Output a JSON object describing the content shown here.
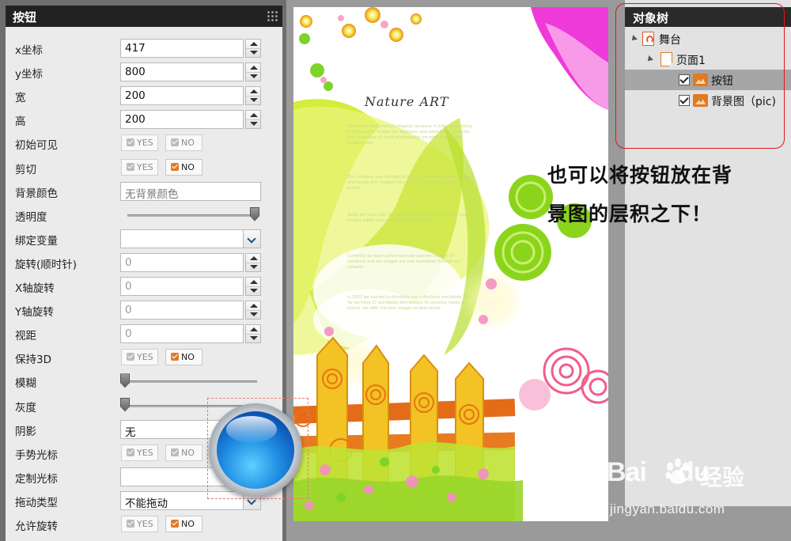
{
  "left_panel": {
    "title": "按钮",
    "properties": [
      {
        "label": "x坐标",
        "type": "number",
        "value": "417"
      },
      {
        "label": "y坐标",
        "type": "number",
        "value": "800"
      },
      {
        "label": "宽",
        "type": "number",
        "value": "200"
      },
      {
        "label": "高",
        "type": "number",
        "value": "200"
      },
      {
        "label": "初始可见",
        "type": "toggle",
        "selected": "none"
      },
      {
        "label": "剪切",
        "type": "toggle",
        "selected": "NO"
      },
      {
        "label": "背景颜色",
        "type": "text",
        "placeholder": "无背景颜色"
      },
      {
        "label": "透明度",
        "type": "slider",
        "level": 1.0
      },
      {
        "label": "绑定变量",
        "type": "select",
        "value": ""
      },
      {
        "label": "旋转(顺时针)",
        "type": "number",
        "value": "0"
      },
      {
        "label": "X轴旋转",
        "type": "number",
        "value": "0"
      },
      {
        "label": "Y轴旋转",
        "type": "number",
        "value": "0"
      },
      {
        "label": "视距",
        "type": "number",
        "value": "0"
      },
      {
        "label": "保持3D",
        "type": "toggle",
        "selected": "NO"
      },
      {
        "label": "模糊",
        "type": "slider",
        "level": 0.0
      },
      {
        "label": "灰度",
        "type": "slider",
        "level": 0.0
      },
      {
        "label": "阴影",
        "type": "select",
        "value": "无"
      },
      {
        "label": "手势光标",
        "type": "toggle",
        "selected": "none"
      },
      {
        "label": "定制光标",
        "type": "select",
        "value": ""
      },
      {
        "label": "拖动类型",
        "type": "select",
        "value": "不能拖动"
      },
      {
        "label": "允许旋转",
        "type": "toggle",
        "selected": "NO"
      }
    ],
    "yes_label": "YES",
    "no_label": "NO",
    "accent_color": "#e07a24"
  },
  "stage": {
    "title": "Nature ART",
    "paragraphs": [
      "We are the first creative imaging company in India specializing in high quality images for designers and advertising agencies. Our collections of stock photography are produced by top professionals.",
      "The company was founded to help in promoting artistic images and design with images from all over the world at affordable prices.",
      "Today we have over 10 million images with over 15,000 new images added every month to our collection.",
      "Currently we have active business partners in over 30 countries and our images are sold worldwide through our network.",
      "In 2002 we started to distribute our collections worldwide. So far we have 27 worldwide distributors. As growing needs of clients, we offer the best images at best prices."
    ]
  },
  "object_tree": {
    "title": "对象树",
    "nodes": [
      {
        "label": "舞台",
        "icon": "stage-icon",
        "level": 0
      },
      {
        "label": "页面1",
        "icon": "page-icon",
        "level": 1
      },
      {
        "label": "按钮",
        "icon": "image-icon",
        "level": 2,
        "checked": true,
        "selected": true
      },
      {
        "label": "背景图（pic)",
        "icon": "image-icon",
        "level": 2,
        "checked": true,
        "selected": false
      }
    ]
  },
  "annotation": {
    "line1": "也可以将按钮放在背",
    "line2": "景图的层积之下！"
  },
  "watermark": {
    "brand": "Bai",
    "brand2": "du",
    "product": "经验",
    "url": "jingyan.baidu.com"
  },
  "colors": {
    "highlight_red": "#e0161b",
    "button_blue": "#1f8ee3",
    "panel_header": "#222222"
  }
}
